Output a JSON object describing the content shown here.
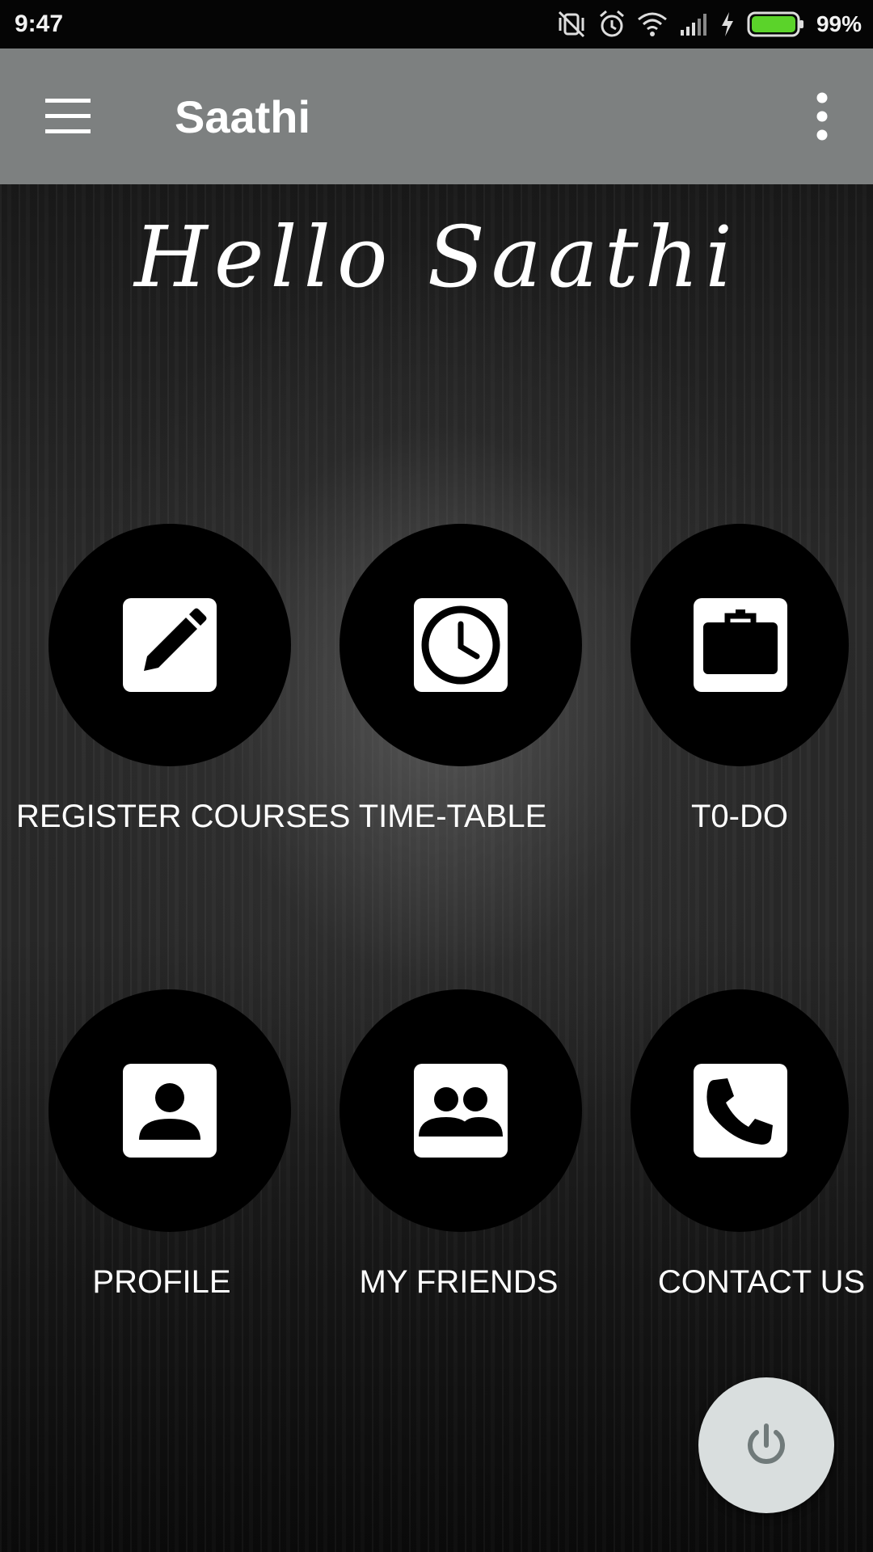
{
  "status_bar": {
    "time": "9:47",
    "battery_percent": "99%",
    "icons": [
      "vibrate-off-icon",
      "alarm-icon",
      "wifi-icon",
      "signal-icon",
      "charging-icon",
      "battery-icon"
    ]
  },
  "app_bar": {
    "title": "Saathi",
    "menu_icon": "hamburger-menu-icon",
    "overflow_icon": "more-vert-icon",
    "color": "#7d8080"
  },
  "greeting": "Hello Saathi",
  "tiles": [
    {
      "label": "REGISTER COURSES",
      "icon": "edit-pencil-icon"
    },
    {
      "label": "TIME-TABLE",
      "icon": "clock-icon"
    },
    {
      "label": "T0-DO",
      "icon": "briefcase-icon"
    },
    {
      "label": "PROFILE",
      "icon": "person-icon"
    },
    {
      "label": "MY FRIENDS",
      "icon": "group-icon"
    },
    {
      "label": "CONTACT US",
      "icon": "phone-icon"
    }
  ],
  "power_button": {
    "icon": "power-icon",
    "color": "#d9dede"
  }
}
